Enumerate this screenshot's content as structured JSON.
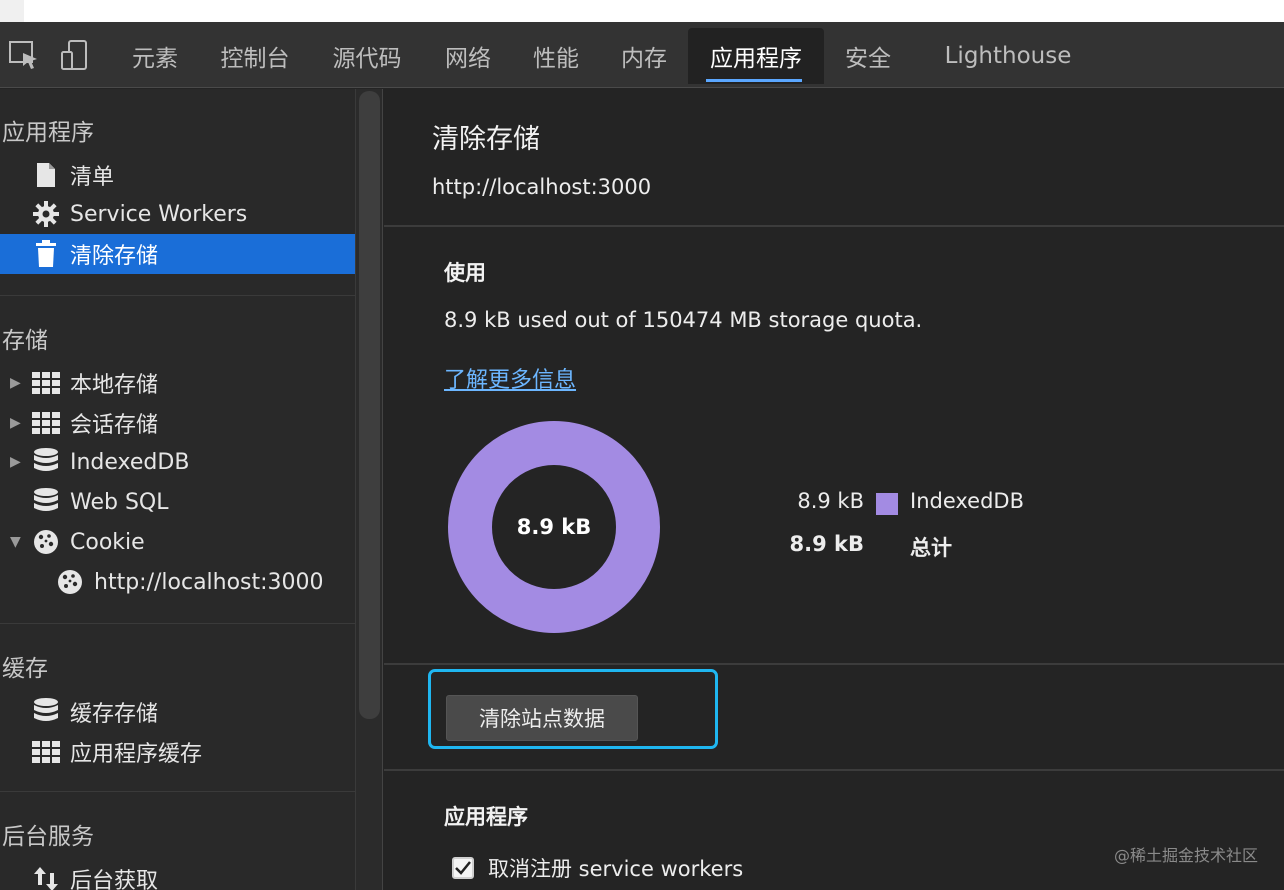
{
  "tabbar": {
    "tabs": [
      "元素",
      "控制台",
      "源代码",
      "网络",
      "性能",
      "内存",
      "应用程序",
      "安全",
      "Lighthouse"
    ],
    "active": "应用程序"
  },
  "sidebar": {
    "sections": {
      "app": "应用程序",
      "storage": "存储",
      "cache": "缓存",
      "background": "后台服务"
    },
    "items": {
      "manifest": "清单",
      "service_workers": "Service Workers",
      "clear_storage": "清除存储",
      "local_storage": "本地存储",
      "session_storage": "会话存储",
      "indexeddb": "IndexedDB",
      "web_sql": "Web SQL",
      "cookie": "Cookie",
      "cookie_origin": "http://localhost:3000",
      "cache_storage": "缓存存储",
      "app_cache": "应用程序缓存",
      "background_fetch": "后台获取"
    }
  },
  "main": {
    "title": "清除存储",
    "origin": "http://localhost:3000",
    "usage_heading": "使用",
    "usage_text": "8.9 kB used out of 150474 MB storage quota.",
    "learn_more": "了解更多信息",
    "donut_label": "8.9 kB",
    "legend": [
      {
        "value": "8.9 kB",
        "name": "IndexedDB",
        "color": "#a38be3"
      },
      {
        "value": "8.9 kB",
        "name": "总计"
      }
    ],
    "clear_button": "清除站点数据",
    "app_heading": "应用程序",
    "unregister_label": "取消注册 service workers",
    "unregister_checked": true
  },
  "watermark": "@稀土掘金技术社区",
  "colors": {
    "accent": "#1a6ed8",
    "tab_underline": "#5ba7ff",
    "donut": "#a38be3",
    "highlight": "#1fb6f0",
    "link": "#6cb6ff"
  }
}
